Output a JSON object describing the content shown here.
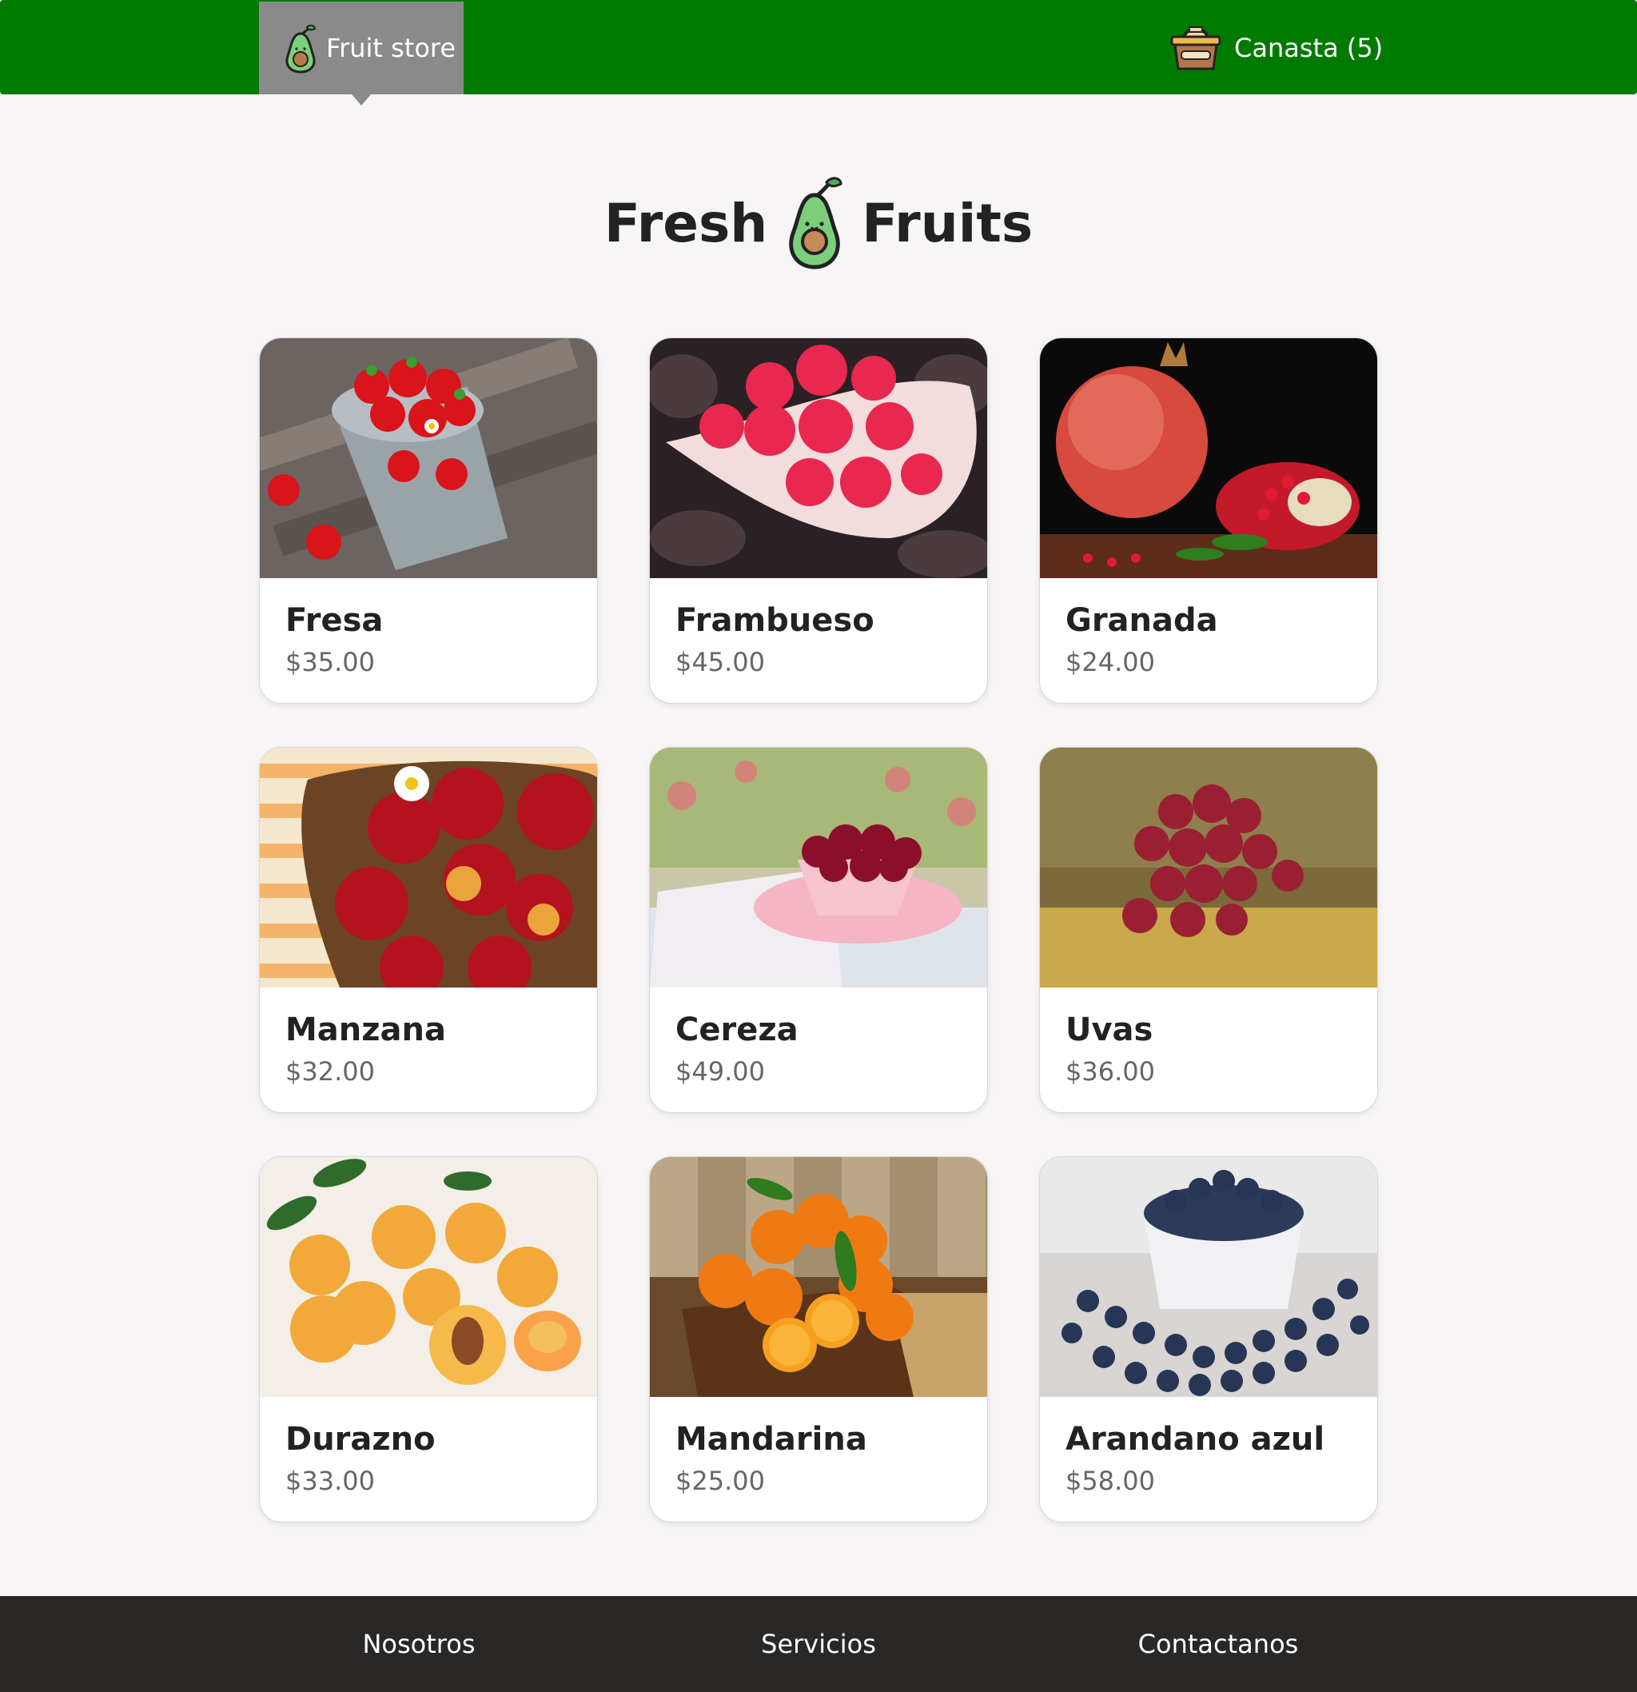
{
  "header": {
    "brand_label": "Fruit store",
    "cart_label": "Canasta (5)",
    "colors": {
      "nav_bg": "#007b00",
      "brand_bg": "#8a8a8a"
    }
  },
  "hero": {
    "word_left": "Fresh",
    "word_right": "Fruits",
    "icon": "avocado-icon"
  },
  "products": [
    {
      "name": "Fresa",
      "price": "$35.00",
      "image": "strawberries-in-metal-bucket"
    },
    {
      "name": "Frambueso",
      "price": "$45.00",
      "image": "raspberries-in-white-bowl"
    },
    {
      "name": "Granada",
      "price": "$24.00",
      "image": "pomegranate-with-seeds"
    },
    {
      "name": "Manzana",
      "price": "$32.00",
      "image": "apples-in-wicker-basket"
    },
    {
      "name": "Cereza",
      "price": "$49.00",
      "image": "cherries-in-pink-bowl"
    },
    {
      "name": "Uvas",
      "price": "$36.00",
      "image": "red-grapes-on-wood"
    },
    {
      "name": "Durazno",
      "price": "$33.00",
      "image": "apricots-halved"
    },
    {
      "name": "Mandarina",
      "price": "$25.00",
      "image": "mandarins-on-cloth"
    },
    {
      "name": "Arandano azul",
      "price": "$58.00",
      "image": "blueberries-in-white-bowl"
    }
  ],
  "footer": {
    "links": [
      "Nosotros",
      "Servicios",
      "Contactanos"
    ],
    "colors": {
      "bg": "#2a2827"
    }
  }
}
